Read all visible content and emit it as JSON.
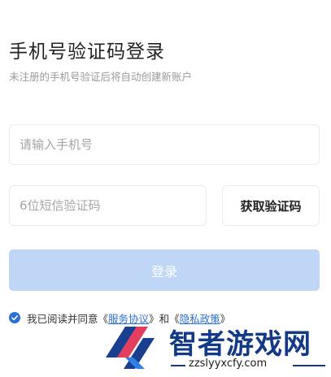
{
  "header": {
    "title": "手机号验证码登录",
    "subtitle": "未注册的手机号验证后将自动创建新账户"
  },
  "form": {
    "phone_placeholder": "请输入手机号",
    "phone_value": "",
    "code_placeholder": "6位短信验证码",
    "code_value": "",
    "get_code_label": "获取验证码",
    "login_label": "登录",
    "login_enabled": false,
    "login_color": "#bfd6f7"
  },
  "agreement": {
    "checked": true,
    "prefix": "我已阅读并同意",
    "open_bracket_1": "《",
    "service_link": "服务协议",
    "close_bracket_1": "》",
    "and": "和",
    "open_bracket_2": "《",
    "privacy_link": "隐私政策",
    "close_bracket_2": "》",
    "accent": "#2b6fd8"
  },
  "watermark": {
    "text": "智者游戏网",
    "url": "zzslyyxcfy.com",
    "icon": "logo-icon"
  }
}
